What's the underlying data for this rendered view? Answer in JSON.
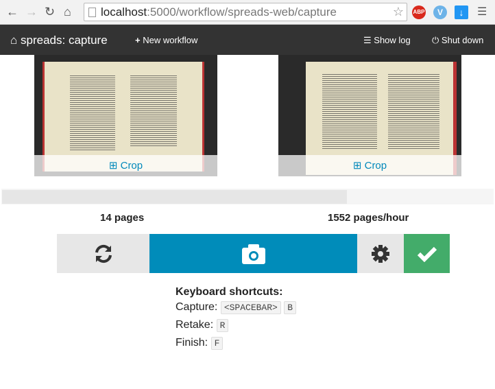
{
  "browser": {
    "url_host": "localhost",
    "url_path": ":5000/workflow/spreads-web/capture",
    "extensions": [
      "ABP",
      "V",
      "download"
    ]
  },
  "navbar": {
    "brand": "spreads: capture",
    "new_workflow": "New workflow",
    "show_log": "Show log",
    "shut_down": "Shut down"
  },
  "previews": [
    {
      "crop_label": "Crop"
    },
    {
      "crop_label": "Crop"
    }
  ],
  "progress": {
    "percent": 70
  },
  "stats": {
    "pages": "14 pages",
    "rate": "1552 pages/hour"
  },
  "colors": {
    "capture": "#008cba",
    "finish": "#43ac6a",
    "neutral": "#e7e7e7",
    "navbar": "#333333"
  },
  "shortcuts": {
    "title": "Keyboard shortcuts:",
    "capture_label": "Capture:",
    "capture_keys": [
      "<SPACEBAR>",
      "B"
    ],
    "retake_label": "Retake:",
    "retake_key": "R",
    "finish_label": "Finish:",
    "finish_key": "F"
  }
}
